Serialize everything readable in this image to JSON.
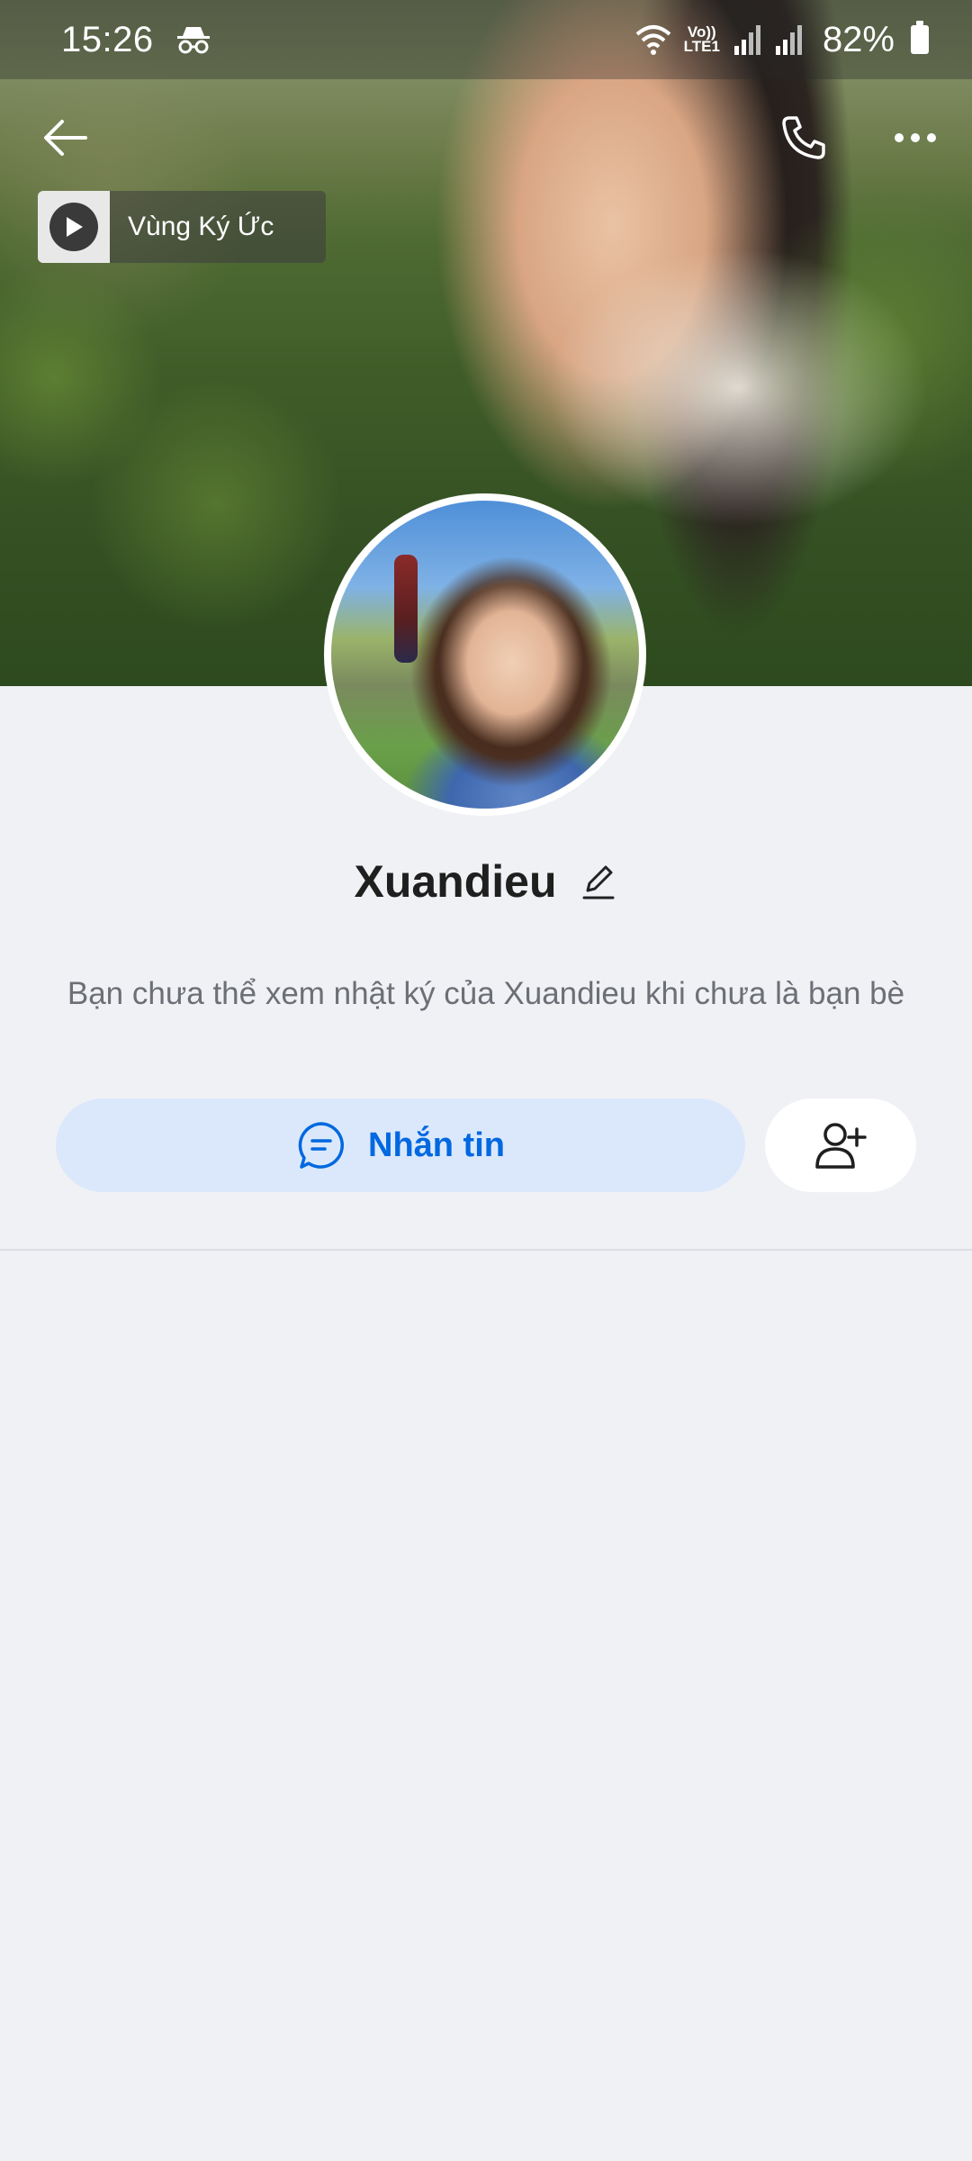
{
  "status_bar": {
    "time": "15:26",
    "volte_top": "Vo))",
    "volte_bottom": "LTE1",
    "battery": "82%"
  },
  "music": {
    "title": "Vùng Ký Ức"
  },
  "profile": {
    "name": "Xuandieu",
    "privacy_notice": "Bạn chưa thể xem nhật ký của Xuandieu khi chưa là bạn bè"
  },
  "actions": {
    "message_label": "Nhắn tin"
  },
  "colors": {
    "accent": "#0068e0",
    "message_bg": "#dbe8fb",
    "page_bg": "#f0f1f5"
  },
  "icons": {
    "back": "arrow-left-icon",
    "call": "phone-icon",
    "more": "more-icon",
    "music_play": "play-icon",
    "edit": "pencil-icon",
    "chat": "chat-bubble-icon",
    "add_friend": "add-user-icon",
    "incognito": "incognito-icon",
    "wifi": "wifi-icon",
    "signal": "signal-icon",
    "battery": "battery-icon"
  }
}
